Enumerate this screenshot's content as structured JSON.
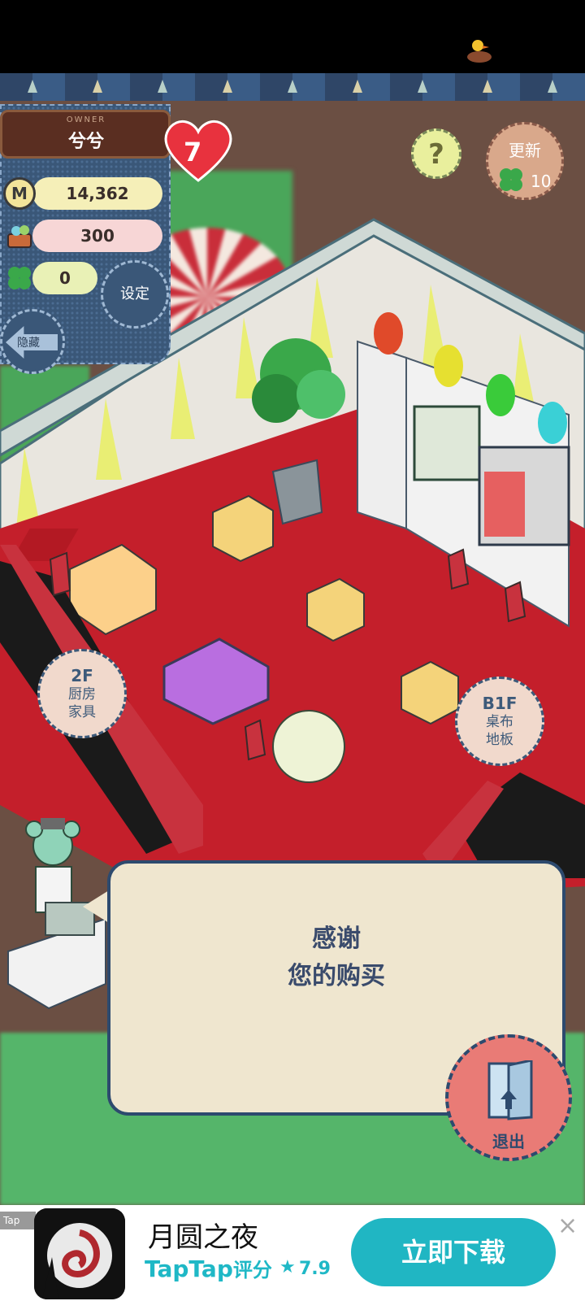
{
  "owner": {
    "title": "OWNER",
    "name": "兮兮"
  },
  "stats": {
    "coins": "14,362",
    "basket": "300",
    "clovers": "0"
  },
  "hearts": "7",
  "buttons": {
    "settings": "设定",
    "hide": "隐藏",
    "help": "?",
    "update": "更新",
    "update_count": "10",
    "exit": "退出"
  },
  "floors": {
    "upper": {
      "floor": "2F",
      "line1": "厨房",
      "line2": "家具"
    },
    "lower": {
      "floor": "B1F",
      "line1": "桌布",
      "line2": "地板"
    }
  },
  "dialog": {
    "line1": "感谢",
    "line2": "您的购买"
  },
  "ad": {
    "tag": "Tap",
    "title": "月圆之夜",
    "brand": "TapTap",
    "rating_label": "评分",
    "score": "7.9",
    "download": "立即下载",
    "close": "×"
  },
  "colors": {
    "accent": "#20b6c3",
    "panel": "#3a5778",
    "floor": "#c41f2b",
    "dialog_bg": "#efe6cf"
  }
}
